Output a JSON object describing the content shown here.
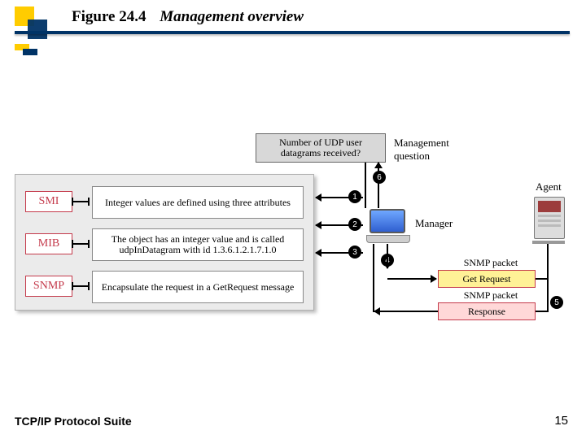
{
  "title": {
    "fig": "Figure 24.4",
    "sub": "Management overview"
  },
  "footer": {
    "left": "TCP/IP Protocol Suite",
    "right": "15"
  },
  "question": {
    "text": "Number of UDP user datagrams received?",
    "label": "Management question"
  },
  "rows": [
    {
      "tag": "SMI",
      "desc": "Integer values are defined using three attributes"
    },
    {
      "tag": "MIB",
      "desc": "The object has an integer value and is called udpInDatagram with id 1.3.6.1.2.1.7.1.0"
    },
    {
      "tag": "SNMP",
      "desc": "Encapsulate the request in a GetRequest message"
    }
  ],
  "manager_label": "Manager",
  "agent_label": "Agent",
  "packets": {
    "get_label": "SNMP packet",
    "get_text": "Get Request",
    "resp_label": "SNMP packet",
    "resp_text": "Response"
  },
  "nums": [
    "1",
    "2",
    "3",
    "4",
    "5",
    "6"
  ]
}
